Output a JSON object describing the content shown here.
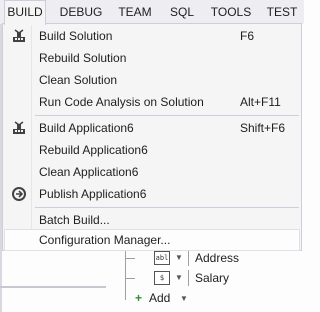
{
  "menubar": {
    "items": [
      "BUILD",
      "DEBUG",
      "TEAM",
      "SQL",
      "TOOLS",
      "TEST"
    ]
  },
  "build_menu": {
    "items": [
      {
        "label": "Build Solution",
        "shortcut": "F6",
        "icon": "build-icon"
      },
      {
        "label": "Rebuild Solution",
        "shortcut": ""
      },
      {
        "label": "Clean Solution",
        "shortcut": ""
      },
      {
        "label": "Run Code Analysis on Solution",
        "shortcut": "Alt+F11"
      },
      {
        "label": "Build Application6",
        "shortcut": "Shift+F6",
        "icon": "build-icon"
      },
      {
        "label": "Rebuild Application6",
        "shortcut": ""
      },
      {
        "label": "Clean Application6",
        "shortcut": ""
      },
      {
        "label": "Publish Application6",
        "shortcut": "",
        "icon": "publish-icon"
      },
      {
        "label": "Batch Build...",
        "shortcut": ""
      },
      {
        "label": "Configuration Manager...",
        "shortcut": ""
      }
    ]
  },
  "tree": {
    "rows": [
      {
        "label": "Address",
        "icon": "text-field-icon"
      },
      {
        "label": "Salary",
        "icon": "money-field-icon"
      }
    ],
    "add_label": "Add",
    "address_icon_text": "abl",
    "salary_icon_text": "$"
  },
  "colors": {
    "menu_background": "#f5f5f5",
    "menubar_background": "#eeeef2",
    "highlight_background": "#fdfdfd",
    "add_plus": "#388a34"
  }
}
